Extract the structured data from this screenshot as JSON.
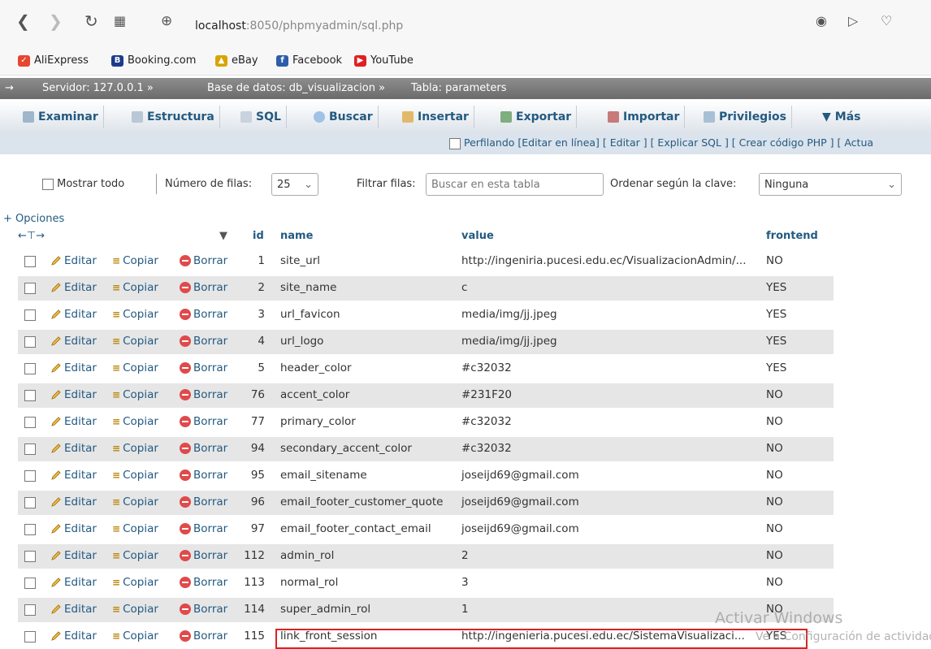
{
  "browser": {
    "url_host": "localhost",
    "url_rest": ":8050/phpmyadmin/sql.php",
    "bookmarks": [
      "AliExpress",
      "Booking.com",
      "eBay",
      "Facebook",
      "YouTube"
    ]
  },
  "breadcrumb": {
    "server": "Servidor: 127.0.0.1 »",
    "database": "Base de datos: db_visualizacion »",
    "table": "Tabla: parameters"
  },
  "tabs": [
    "Examinar",
    "Estructura",
    "SQL",
    "Buscar",
    "Insertar",
    "Exportar",
    "Importar",
    "Privilegios",
    "Más"
  ],
  "subbar": "Perfilando [Editar en línea] [ Editar ] [ Explicar SQL ] [ Crear código PHP ] [ Actua",
  "filters": {
    "show_all": "Mostrar todo",
    "rows_label": "Número de filas:",
    "rows_value": "25",
    "filter_label": "Filtrar filas:",
    "filter_placeholder": "Buscar en esta tabla",
    "sort_label": "Ordenar según la clave:",
    "sort_value": "Ninguna"
  },
  "options_link": "+ Opciones",
  "columns": {
    "id": "id",
    "name": "name",
    "value": "value",
    "frontend": "frontend"
  },
  "actions": {
    "edit": "Editar",
    "copy": "Copiar",
    "delete": "Borrar"
  },
  "rows": [
    {
      "id": "1",
      "name": "site_url",
      "value": "http://ingeniria.pucesi.edu.ec/VisualizacionAdmin/...",
      "frontend": "NO"
    },
    {
      "id": "2",
      "name": "site_name",
      "value": "c",
      "frontend": "YES"
    },
    {
      "id": "3",
      "name": "url_favicon",
      "value": "media/img/jj.jpeg",
      "frontend": "YES"
    },
    {
      "id": "4",
      "name": "url_logo",
      "value": "media/img/jj.jpeg",
      "frontend": "YES"
    },
    {
      "id": "5",
      "name": "header_color",
      "value": "#c32032",
      "frontend": "YES"
    },
    {
      "id": "76",
      "name": "accent_color",
      "value": "#231F20",
      "frontend": "NO"
    },
    {
      "id": "77",
      "name": "primary_color",
      "value": "#c32032",
      "frontend": "NO"
    },
    {
      "id": "94",
      "name": "secondary_accent_color",
      "value": "#c32032",
      "frontend": "NO"
    },
    {
      "id": "95",
      "name": "email_sitename",
      "value": "joseijd69@gmail.com",
      "frontend": "NO"
    },
    {
      "id": "96",
      "name": "email_footer_customer_quote",
      "value": "joseijd69@gmail.com",
      "frontend": "NO"
    },
    {
      "id": "97",
      "name": "email_footer_contact_email",
      "value": "joseijd69@gmail.com",
      "frontend": "NO"
    },
    {
      "id": "112",
      "name": "admin_rol",
      "value": "2",
      "frontend": "NO"
    },
    {
      "id": "113",
      "name": "normal_rol",
      "value": "3",
      "frontend": "NO"
    },
    {
      "id": "114",
      "name": "super_admin_rol",
      "value": "1",
      "frontend": "NO"
    },
    {
      "id": "115",
      "name": "link_front_session",
      "value": "http://ingenieria.pucesi.edu.ec/SistemaVisualizaci...",
      "frontend": "YES"
    }
  ],
  "watermark": {
    "line1": "Activar Windows",
    "line2": "Ve a Configuración de actividades pa"
  }
}
